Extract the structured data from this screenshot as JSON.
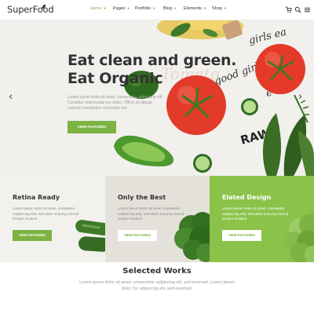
{
  "header": {
    "logo": "SuperFood",
    "nav": [
      {
        "label": "Home",
        "active": true
      },
      {
        "label": "Pages",
        "active": false
      },
      {
        "label": "Portfolio",
        "active": false
      },
      {
        "label": "Blog",
        "active": false
      },
      {
        "label": "Elements",
        "active": false
      },
      {
        "label": "Shop",
        "active": false
      }
    ],
    "icons": [
      "cart-icon",
      "search-icon",
      "menu-icon"
    ]
  },
  "hero": {
    "title_line1": "Eat clean and green.",
    "title_line2": "Eat Organic",
    "text": "Lorem ipsum dolor sit amet, consectetur adipiscing elit. Curabitur malesuada nec tellus. Officis sit aliquip nostrud exercitation commodo est",
    "button": "VIEW FEATURES",
    "prev_icon": "chevron-left-icon",
    "next_icon": "chevron-right-icon"
  },
  "panels": [
    {
      "title": "Retina Ready",
      "text": "Lorem ipsum dolor sit amet, consetetur sadipscing elitr, sed diam nonumy eirmod tempor invidunt",
      "button": "VIEW FEATURES"
    },
    {
      "title": "Only the Best",
      "text": "Lorem ipsum dolor sit amet, consetetur sadipscing elitr, sed diam nonumy eirmod tempor invidunt",
      "button": "VIEW FEATURES"
    },
    {
      "title": "Elated Design",
      "text": "Lorem ipsum dolor sit amet, consetetur sadipscing elitr, sed diam nonumy eirmod tempor invidunt",
      "button": "VIEW FEATURES"
    }
  ],
  "works": {
    "title": "Selected Works",
    "text": "Lorem ipsum dolor sit amet, consectetur adipiscing elit, sed eiusmod. Lorem ipsum dolor Tur adipiscing elit, sed eiusmod."
  },
  "colors": {
    "accent": "#7cb342",
    "accent_light": "#8bc34a",
    "text_dark": "#333333",
    "hero_bg": "#f1f0ed"
  }
}
